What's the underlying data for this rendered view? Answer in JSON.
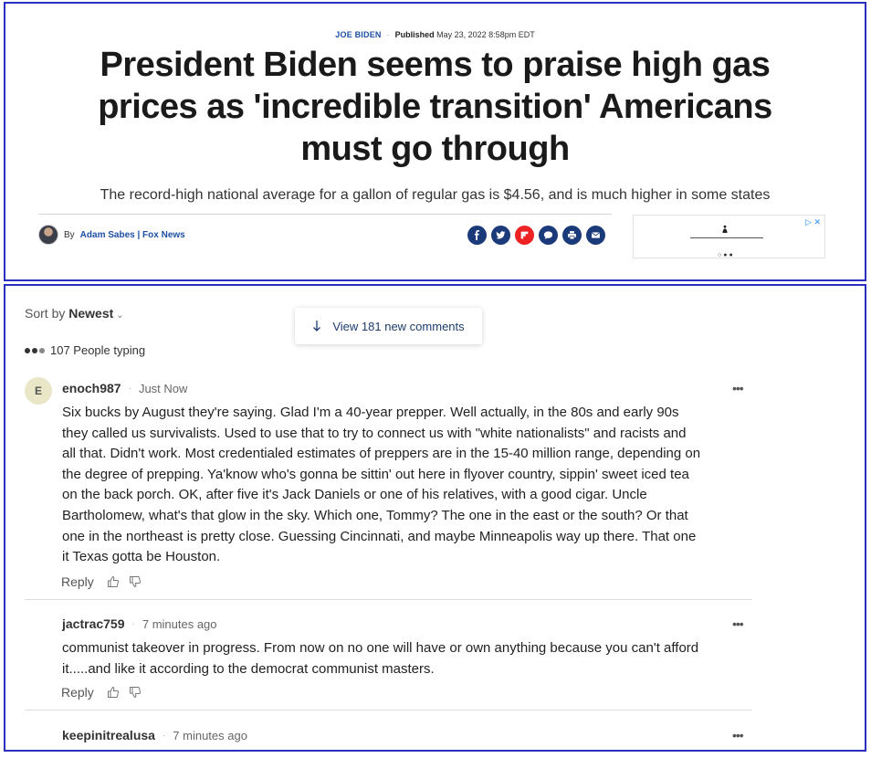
{
  "article": {
    "category": "JOE BIDEN",
    "published_label": "Published",
    "published_date": "May 23, 2022 8:58pm EDT",
    "headline": "President Biden seems to praise high gas prices as 'incredible transition' Americans must go through",
    "subheadline": "The record-high national average for a gallon of regular gas is $4.56, and is much higher in some states",
    "byline_prefix": "By",
    "author": "Adam Sabes | Fox News",
    "share_icons": [
      "facebook-icon",
      "twitter-icon",
      "flipboard-icon",
      "comment-icon",
      "print-icon",
      "email-icon"
    ],
    "ad_badges": "▷ ✕"
  },
  "comments_section": {
    "sort_label": "Sort by",
    "sort_value": "Newest",
    "new_comments_label": "View 181 new comments",
    "typing_label": "107 People typing",
    "reply_label": "Reply",
    "comments": [
      {
        "avatar_initial": "E",
        "username": "enoch987",
        "time": "Just Now",
        "body": "Six bucks by August they're saying.   Glad I'm a 40-year prepper.  Well actually, in the 80s and early 90s they called us survivalists. Used to use that to try to connect us with \"white nationalists\" and racists and all that.  Didn't work.   Most credentialed estimates of preppers are in the 15-40 million range, depending on the degree of prepping.  Ya'know who's gonna be sittin' out here in flyover country, sippin' sweet iced tea on the back porch.  OK, after five it's Jack Daniels or one of his relatives, with a good cigar.  Uncle Bartholomew, what's that glow in the sky.  Which one, Tommy? The one in the east or the south?  Or that one in the northeast is pretty close.  Guessing Cincinnati, and maybe Minneapolis way up there.  That one it Texas gotta be Houston."
      },
      {
        "username": "jactrac759",
        "time": "7 minutes ago",
        "body": "communist takeover in progress. From now on no one will have or own anything because you can't afford it.....and like it according to the democrat communist masters."
      },
      {
        "username": "keepinitrealusa",
        "time": "7 minutes ago",
        "body": ""
      }
    ]
  },
  "colors": {
    "frame_border": "#2a2fbd",
    "link_blue": "#1d4fa3",
    "share_navy": "#1b3a7a",
    "flipboard_red": "#ee2222"
  }
}
